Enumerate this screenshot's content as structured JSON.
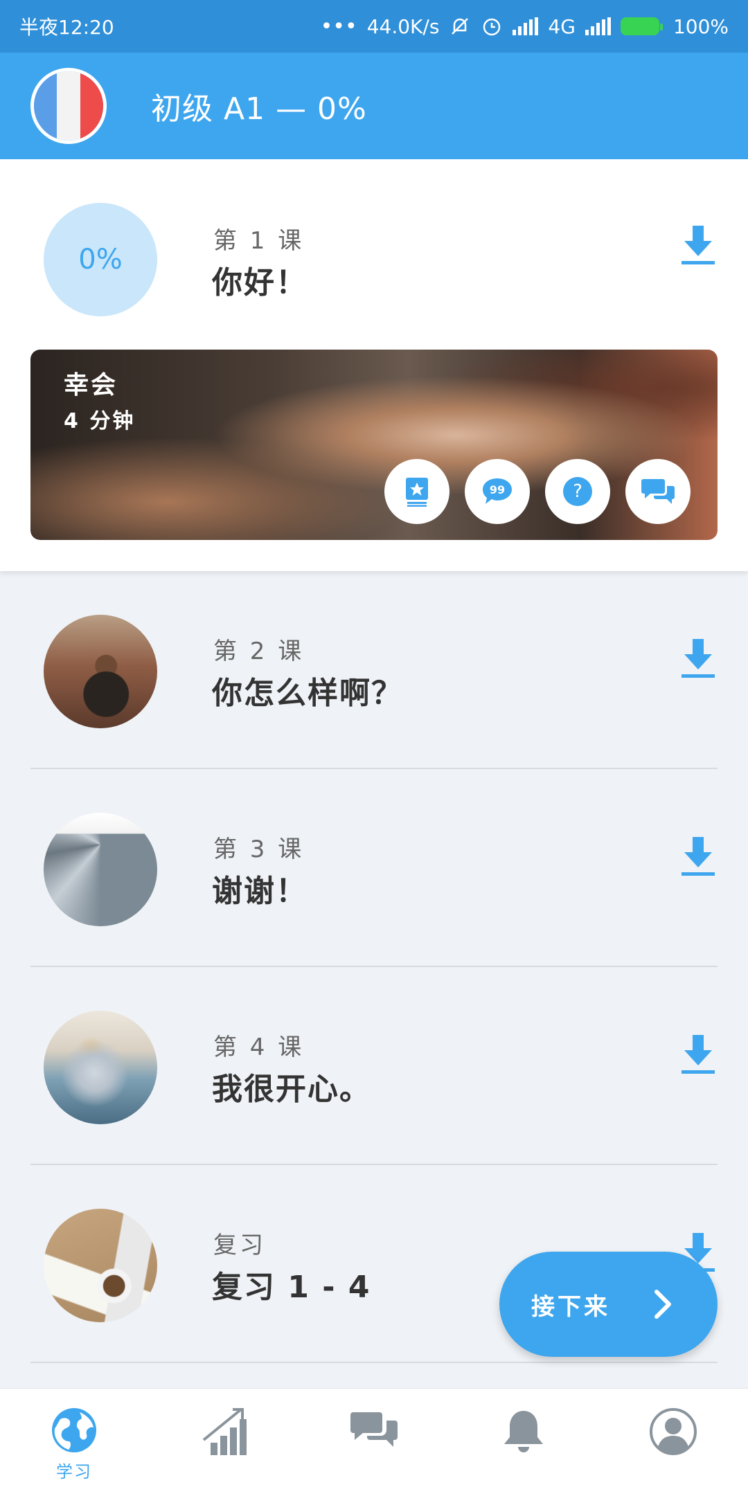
{
  "status_bar": {
    "time": "半夜12:20",
    "net_speed": "44.0K/s",
    "network": "4G",
    "battery": "100%"
  },
  "header": {
    "title": "初级 A1 — 0%"
  },
  "lesson1": {
    "progress": "0%",
    "number": "第 1 课",
    "title": "你好！",
    "media": {
      "title": "幸会",
      "duration": "4 分钟"
    },
    "actions": [
      "vocabulary-icon",
      "quote-icon",
      "question-icon",
      "dialogue-icon"
    ]
  },
  "lessons": [
    {
      "number": "第 2 课",
      "title": "你怎么样啊？"
    },
    {
      "number": "第 3 课",
      "title": "谢谢！"
    },
    {
      "number": "第 4 课",
      "title": "我很开心。"
    },
    {
      "number": "复习",
      "title": "复习 1 - 4"
    }
  ],
  "next_button": {
    "label": "接下来"
  },
  "bottom_nav": {
    "items": [
      {
        "icon": "globe-icon",
        "label": "学习",
        "active": true
      },
      {
        "icon": "chart-icon",
        "label": ""
      },
      {
        "icon": "chat-icon",
        "label": ""
      },
      {
        "icon": "bell-icon",
        "label": ""
      },
      {
        "icon": "profile-icon",
        "label": ""
      }
    ]
  },
  "colors": {
    "primary": "#3ea6ee",
    "status_bar": "#2f8fd8",
    "progress_bg": "#c9e6fb",
    "list_bg": "#eff2f6"
  }
}
